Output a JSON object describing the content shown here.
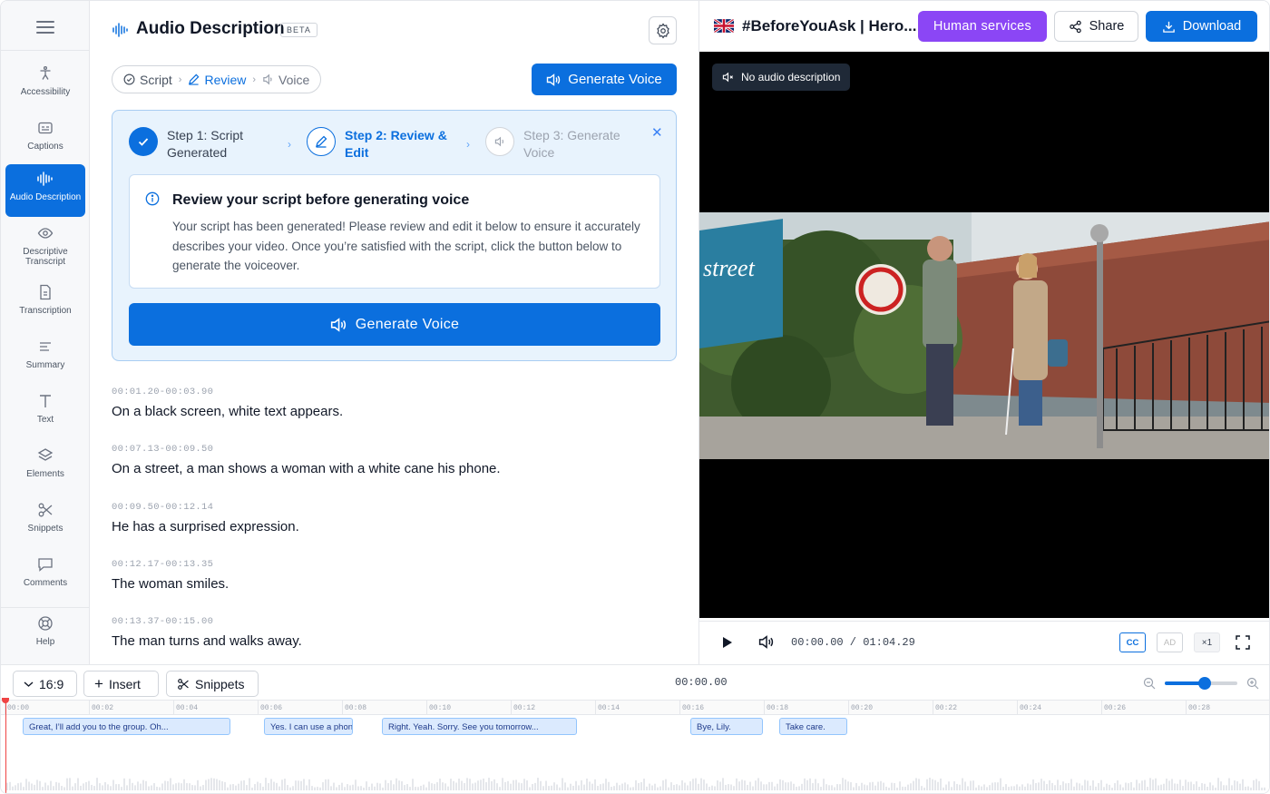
{
  "sidebar": {
    "items": [
      {
        "label": "Accessibility",
        "icon": "accessibility-icon",
        "active": false
      },
      {
        "label": "Captions",
        "icon": "captions-icon",
        "active": false
      },
      {
        "label": "Audio Description",
        "icon": "audio-wave-icon",
        "active": true
      },
      {
        "label": "Descriptive Transcript",
        "icon": "eye-icon",
        "active": false
      },
      {
        "label": "Transcription",
        "icon": "document-icon",
        "active": false
      },
      {
        "label": "Summary",
        "icon": "summary-lines-icon",
        "active": false
      },
      {
        "label": "Text",
        "icon": "text-t-icon",
        "active": false
      },
      {
        "label": "Elements",
        "icon": "layers-icon",
        "active": false
      },
      {
        "label": "Snippets",
        "icon": "scissors-icon",
        "active": false
      },
      {
        "label": "Comments",
        "icon": "comment-icon",
        "active": false
      }
    ],
    "help": "Help"
  },
  "panel": {
    "title": "Audio Description",
    "badge": "BETA",
    "breadcrumbs": [
      {
        "label": "Script",
        "state": "done"
      },
      {
        "label": "Review",
        "state": "active"
      },
      {
        "label": "Voice",
        "state": "pending"
      }
    ],
    "generate_button": "Generate Voice"
  },
  "steps": {
    "step1": "Step 1: Script Generated",
    "step2": "Step 2: Review & Edit",
    "step3": "Step 3: Generate Voice",
    "review_title": "Review your script before generating voice",
    "review_body": "Your script has been generated! Please review and edit it below to ensure it accurately describes your video. Once you’re satisfied with the script, click the button below to generate the voiceover.",
    "generate_button": "Generate Voice"
  },
  "script": [
    {
      "time": "00:01.20-00:03.90",
      "text": "On a black screen, white text appears."
    },
    {
      "time": "00:07.13-00:09.50",
      "text": "On a street, a man shows a woman with a white cane his phone."
    },
    {
      "time": "00:09.50-00:12.14",
      "text": "He has a surprised expression."
    },
    {
      "time": "00:12.17-00:13.35",
      "text": "The woman smiles."
    },
    {
      "time": "00:13.37-00:15.00",
      "text": "The man turns and walks away."
    }
  ],
  "video": {
    "title": "#BeforeYouAsk | Hero...",
    "human_services": "Human services",
    "share": "Share",
    "download": "Download",
    "audio_pill": "No audio description",
    "time": "00:00.00 / 01:04.29",
    "cc": "CC",
    "ad": "AD",
    "speed": "×1",
    "scene_text": "street"
  },
  "timeline": {
    "aspect": "16:9",
    "insert": "Insert",
    "snippets": "Snippets",
    "time": "00:00.00",
    "ticks": [
      "00:00",
      "00:02",
      "00:04",
      "00:06",
      "00:08",
      "00:10",
      "00:12",
      "00:14",
      "00:16",
      "00:18",
      "00:20",
      "00:22",
      "00:24",
      "00:26",
      "00:28"
    ],
    "clips": [
      "Great, I’ll add you to the group. Oh...",
      "Yes. I can use a phone",
      "Right. Yeah. Sorry. See you tomorrow...",
      "Bye, Lily.",
      "Take care."
    ],
    "zoom_level": 0.55
  },
  "colors": {
    "accent": "#0b6fde",
    "purple": "#8b46f5",
    "playhead": "#ef4444"
  }
}
